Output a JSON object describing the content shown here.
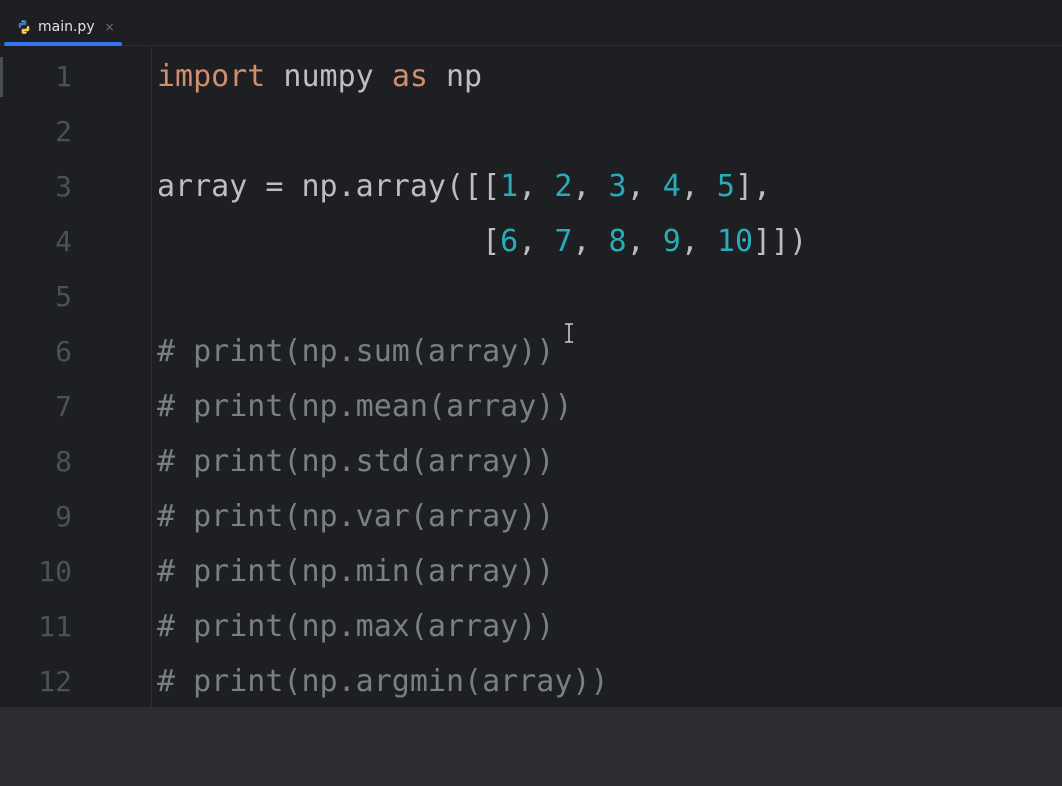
{
  "tabs": [
    {
      "label": "main.py",
      "close": "×",
      "active": true
    }
  ],
  "editor": {
    "line_numbers": [
      "1",
      "2",
      "3",
      "4",
      "5",
      "6",
      "7",
      "8",
      "9",
      "10",
      "11",
      "12"
    ],
    "lines": [
      [
        {
          "t": "import",
          "c": "kw"
        },
        {
          "t": " numpy ",
          "c": "txt"
        },
        {
          "t": "as",
          "c": "kw"
        },
        {
          "t": " np",
          "c": "txt"
        }
      ],
      [],
      [
        {
          "t": "array = np.array([[",
          "c": "txt"
        },
        {
          "t": "1",
          "c": "num"
        },
        {
          "t": ", ",
          "c": "txt"
        },
        {
          "t": "2",
          "c": "num"
        },
        {
          "t": ", ",
          "c": "txt"
        },
        {
          "t": "3",
          "c": "num"
        },
        {
          "t": ", ",
          "c": "txt"
        },
        {
          "t": "4",
          "c": "num"
        },
        {
          "t": ", ",
          "c": "txt"
        },
        {
          "t": "5",
          "c": "num"
        },
        {
          "t": "],",
          "c": "txt"
        }
      ],
      [
        {
          "t": "                  [",
          "c": "txt"
        },
        {
          "t": "6",
          "c": "num"
        },
        {
          "t": ", ",
          "c": "txt"
        },
        {
          "t": "7",
          "c": "num"
        },
        {
          "t": ", ",
          "c": "txt"
        },
        {
          "t": "8",
          "c": "num"
        },
        {
          "t": ", ",
          "c": "txt"
        },
        {
          "t": "9",
          "c": "num"
        },
        {
          "t": ", ",
          "c": "txt"
        },
        {
          "t": "10",
          "c": "num"
        },
        {
          "t": "]])",
          "c": "txt"
        }
      ],
      [],
      [
        {
          "t": "# print(np.sum(array))",
          "c": "cm"
        }
      ],
      [
        {
          "t": "# print(np.mean(array))",
          "c": "cm"
        }
      ],
      [
        {
          "t": "# print(np.std(array))",
          "c": "cm"
        }
      ],
      [
        {
          "t": "# print(np.var(array))",
          "c": "cm"
        }
      ],
      [
        {
          "t": "# print(np.min(array))",
          "c": "cm"
        }
      ],
      [
        {
          "t": "# print(np.max(array))",
          "c": "cm"
        }
      ],
      [
        {
          "t": "# print(np.argmin(array))",
          "c": "cm"
        }
      ]
    ]
  },
  "colors": {
    "keyword": "#cf8e6d",
    "number": "#2aacb8",
    "comment": "#7a7e85",
    "text": "#bcbec4",
    "line_number": "#4b5059",
    "background": "#1e1f22",
    "tab_accent": "#3574f0"
  },
  "icons": {
    "tab_file": "python-icon",
    "mouse_cursor": "text-cursor-icon"
  }
}
